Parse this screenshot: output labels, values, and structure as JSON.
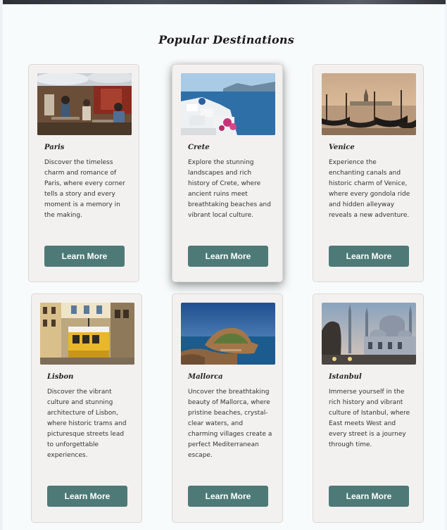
{
  "section": {
    "title": "Popular Destinations"
  },
  "button_label": "Learn More",
  "destinations": [
    {
      "name": "Paris",
      "description": "Discover the timeless charm and romance of Paris, where every corner tells a story and every moment is a memory in the making.",
      "image": "cafe-street-photo"
    },
    {
      "name": "Crete",
      "description": "Explore the stunning landscapes and rich history of Crete, where ancient ruins meet breathtaking beaches and vibrant local culture.",
      "image": "white-village-sea-photo"
    },
    {
      "name": "Venice",
      "description": "Experience the enchanting canals and historic charm of Venice, where every gondola ride and hidden alleyway reveals a new adventure.",
      "image": "gondolas-sunset-photo"
    },
    {
      "name": "Lisbon",
      "description": "Discover the vibrant culture and stunning architecture of Lisbon, where historic trams and picturesque streets lead to unforgettable experiences.",
      "image": "yellow-tram-street-photo"
    },
    {
      "name": "Mallorca",
      "description": "Uncover the breathtaking beauty of Mallorca, where pristine beaches, crystal-clear waters, and charming villages create a perfect Mediterranean escape.",
      "image": "rocky-coast-sea-photo"
    },
    {
      "name": "Istanbul",
      "description": "Immerse yourself in the rich history and vibrant culture of Istanbul, where East meets West and every street is a journey through time.",
      "image": "mosque-minarets-photo"
    }
  ]
}
